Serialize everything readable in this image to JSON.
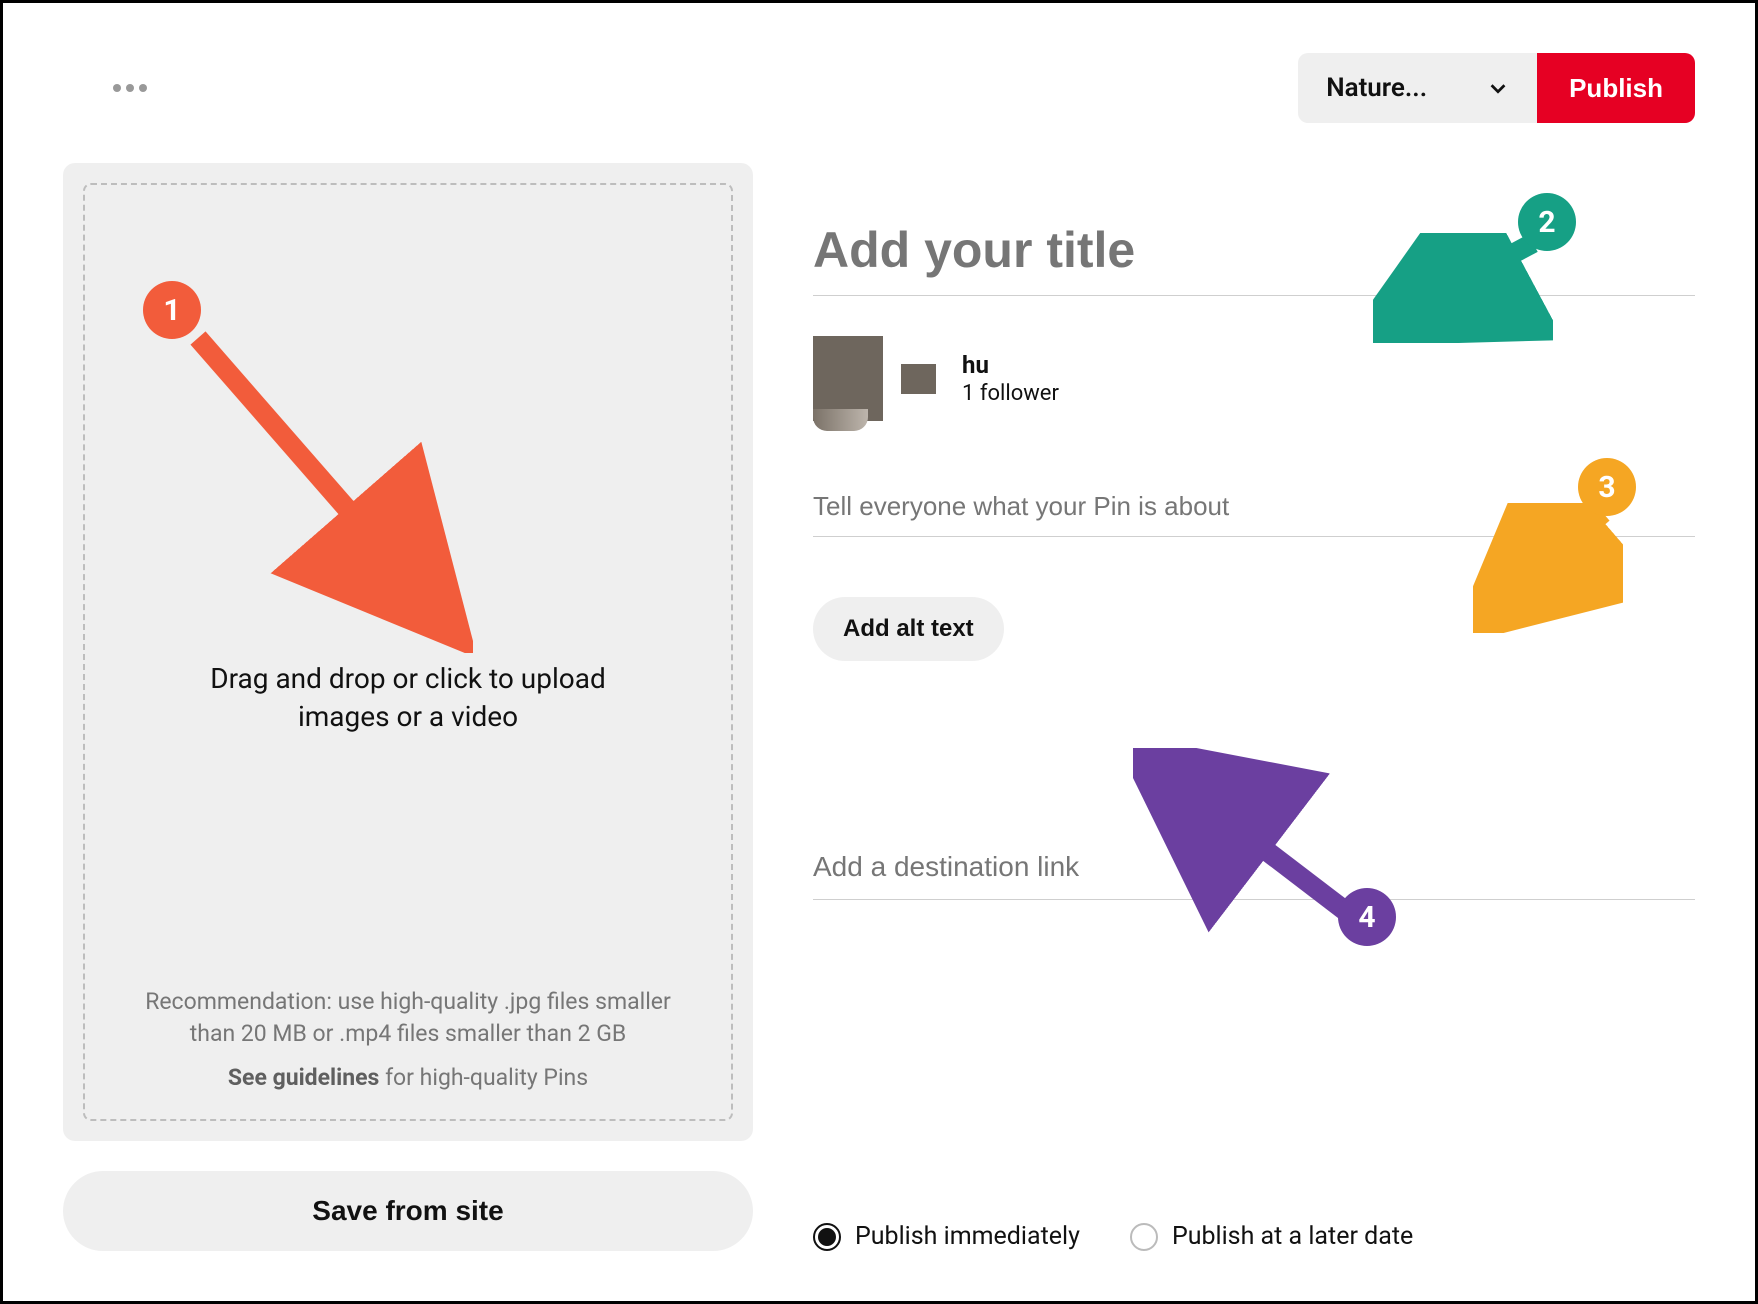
{
  "topbar": {
    "board_selected": "Nature...",
    "publish_label": "Publish"
  },
  "upload": {
    "main_text": "Drag and drop or click to upload images or a video",
    "recommendation": "Recommendation: use high-quality .jpg files smaller than 20 MB or .mp4 files smaller than 2 GB",
    "guidelines_strong": "See guidelines",
    "guidelines_rest": " for high-quality Pins"
  },
  "save_from_site_label": "Save from site",
  "form": {
    "title_placeholder": "Add your title",
    "desc_placeholder": "Tell everyone what your Pin is about",
    "alt_text_label": "Add alt text",
    "link_placeholder": "Add a destination link"
  },
  "profile": {
    "name": "hu",
    "followers": "1 follower"
  },
  "publish_options": {
    "immediate": "Publish immediately",
    "later": "Publish at a later date"
  },
  "annotations": {
    "b1": "1",
    "b2": "2",
    "b3": "3",
    "b4": "4"
  },
  "colors": {
    "badge1": "#f25c3b",
    "badge2": "#16a085",
    "badge3": "#f5a623",
    "badge4": "#6b3fa0",
    "publish": "#e60023"
  }
}
